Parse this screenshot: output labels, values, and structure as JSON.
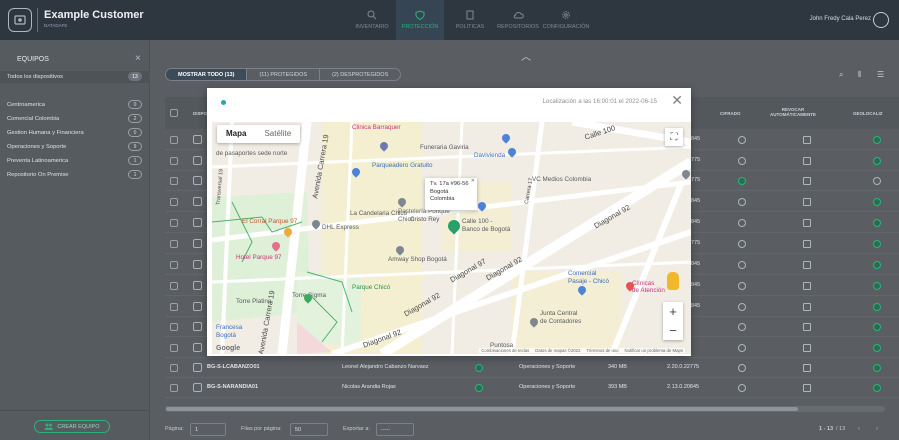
{
  "header": {
    "title": "Example Customer",
    "subtitle": "DATADAFE",
    "user": "John Fredy Cala Perez",
    "nav": [
      {
        "label": "INVENTARIO"
      },
      {
        "label": "PROTECCIÓN"
      },
      {
        "label": "POLITICAS"
      },
      {
        "label": "REPOSITORIOS"
      },
      {
        "label": "CONFIGURACIÓN"
      }
    ]
  },
  "sidebar": {
    "title": "EQUIPOS",
    "all_label": "Todos los dispositivos",
    "all_count": "13",
    "groups": [
      {
        "name": "Centroamerica",
        "count": "0"
      },
      {
        "name": "Comercial Colombia",
        "count": "2"
      },
      {
        "name": "Gestion Humana y Financiera",
        "count": "0"
      },
      {
        "name": "Operaciones y Soporte",
        "count": "9"
      },
      {
        "name": "Preventa Latinoamerica",
        "count": "1"
      },
      {
        "name": "Repositorio On Premise",
        "count": "1"
      }
    ],
    "create_label": "CREAR EQUIPO"
  },
  "filters": {
    "all": "MOSTRAR TODO (13)",
    "protected": "(11) PROTEGIDOS",
    "unprotected": "(2) DESPROTEGIDOS"
  },
  "table": {
    "headers": {
      "device": "DISPO",
      "cifrado": "CIFRADO",
      "revocar": "REVOCAR AUTOMÁTICAMENTE",
      "geo": "GEOLOCALIZ"
    },
    "partial_versions": [
      "845",
      "775",
      "775",
      "845",
      "845",
      "775",
      "845",
      "845",
      "845"
    ],
    "rows": [
      {
        "name": "BG-S-LCABANZO01",
        "user": "Leonel Alejandro Cabanzo Narvaez",
        "group": "Operaciones y Soporte",
        "size": "340 MB",
        "version": "2.20.0.22775"
      },
      {
        "name": "BG-S-NARANDIA01",
        "user": "Nicolas Arandia Rojas",
        "group": "Operaciones y Soporte",
        "size": "393 MB",
        "version": "2.13.0.20845"
      }
    ]
  },
  "pager": {
    "page_label": "Página:",
    "page": "1",
    "per_page_label": "Filas por página:",
    "per_page": "50",
    "export_label": "Exportar a:",
    "export": "-----",
    "range": "1 - 13",
    "total": "/ 13"
  },
  "modal": {
    "location": "Localización a las 16:00:01 el 2022-06-15",
    "map_tab": "Mapa",
    "sat_tab": "Satélite",
    "popup": [
      "Tv. 17a #96-56",
      "Bogotá",
      "Colombia"
    ],
    "places": {
      "clinica": "Clinica Barraquer",
      "parqueadero": "Parqueadero Gratuito",
      "funeraria": "Funeraria Gaviria",
      "davivienda": "Davivienda",
      "vc": "VC Medios Colombia",
      "pasaportes": "de pasaportes sede norte",
      "corral": "El Corral Parque 97",
      "dhl": "DHL Express",
      "candelaria": "La Candelaria Chicó",
      "pasteleria": "Pastelería Ponqué",
      "chico": "Chicó",
      "cristo": "Cristo Rey",
      "calle100b": "Calle 100 -",
      "bancobog": "Banco de Bogotá",
      "hotel": "Hotel Parque 97",
      "amway": "Amway Shop Bogotá",
      "torre": "Torre Sigma",
      "parquechico": "Parque Chicó",
      "torreplatino": "Torre Platino",
      "francesa": "Francesa",
      "bogota": "Bogotá",
      "comercial": "Comercial",
      "pasaje": "Pasaje - Chicó",
      "clinicas": "Clínicas",
      "atencion": "de Atención",
      "junta": "Junta Central",
      "contadores": "de Contadores",
      "puntosa": "Puntosa",
      "carrera15": "Carrera 15"
    },
    "roads": {
      "calle100": "Calle 100",
      "diagonal92a": "Diagonal 92",
      "diagonal92b": "Diagonal 92",
      "diagonal92c": "Diagonal 92",
      "diagonal92d": "Diagonal 92",
      "diagonal97": "Diagonal 97",
      "av_carrera19": "Avenida Carrera 19",
      "av_carrera19b": "Avenida Carrera 19",
      "av_calle": "Avenida Calle",
      "calle17": "Carrera 17",
      "transversal": "Transversal 19"
    },
    "google": "Google",
    "attribution": [
      "Combinaciones de teclas",
      "Datos de mapas ©2022",
      "Términos de uso",
      "Notificar un problema de Maps"
    ]
  }
}
